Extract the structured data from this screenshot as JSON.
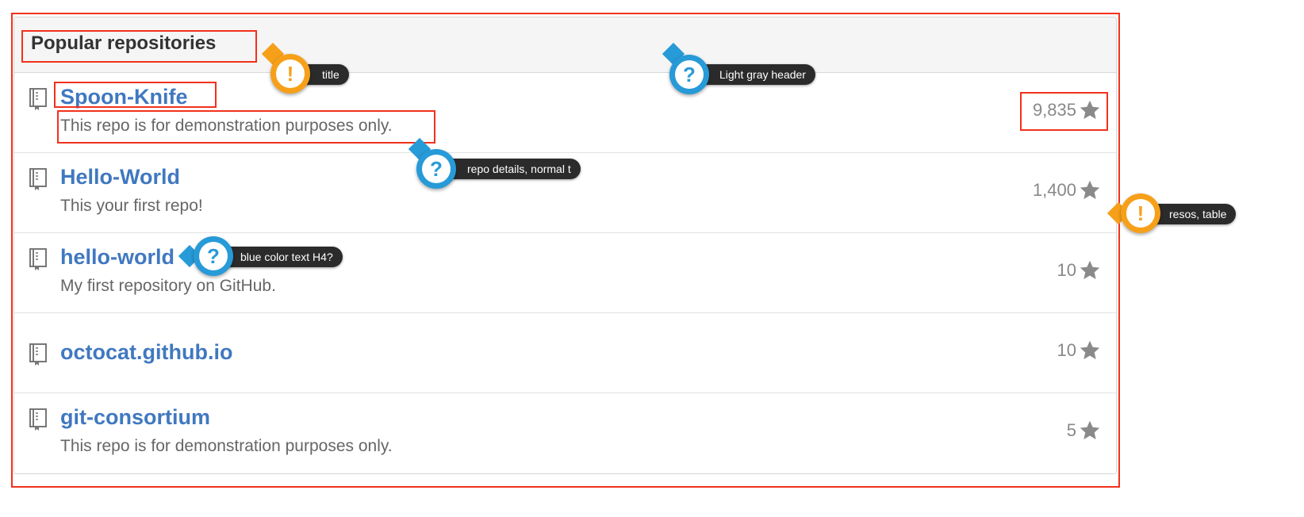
{
  "panel": {
    "title": "Popular repositories",
    "repos": [
      {
        "name": "Spoon-Knife",
        "description": "This repo is for demonstration purposes only.",
        "stars": "9,835"
      },
      {
        "name": "Hello-World",
        "description": "This your first repo!",
        "stars": "1,400"
      },
      {
        "name": "hello-world",
        "description": "My first repository on GitHub.",
        "stars": "10"
      },
      {
        "name": "octocat.github.io",
        "description": "",
        "stars": "10"
      },
      {
        "name": "git-consortium",
        "description": "This repo is for demonstration purposes only.",
        "stars": "5"
      }
    ]
  },
  "annotations": {
    "title": {
      "symbol": "!",
      "label": "title"
    },
    "header": {
      "symbol": "?",
      "label": "Light gray header"
    },
    "details": {
      "symbol": "?",
      "label": "repo details, normal t"
    },
    "table": {
      "symbol": "!",
      "label": "resos, table"
    },
    "h4": {
      "symbol": "?",
      "label": "blue color text H4?"
    }
  },
  "icons": {
    "repo": "repo-book-icon",
    "star": "star-icon"
  },
  "colors": {
    "link": "#4078c0",
    "header_bg": "#f5f5f5",
    "highlight": "#f2311c",
    "annotation_warning": "#f6a01a",
    "annotation_question": "#279ad8"
  }
}
